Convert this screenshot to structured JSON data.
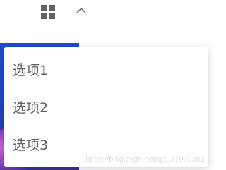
{
  "toolbar": {
    "grid_icon": "apps-grid-icon",
    "chevron_icon": "chevron-up-icon",
    "icon_color": "#606266"
  },
  "dropdown": {
    "items": [
      {
        "label": "选项1"
      },
      {
        "label": "选项2"
      },
      {
        "label": "选项3"
      }
    ],
    "text_color": "#606266"
  },
  "watermark": {
    "text": "https://blog.csdn.net/qq_37099362"
  }
}
